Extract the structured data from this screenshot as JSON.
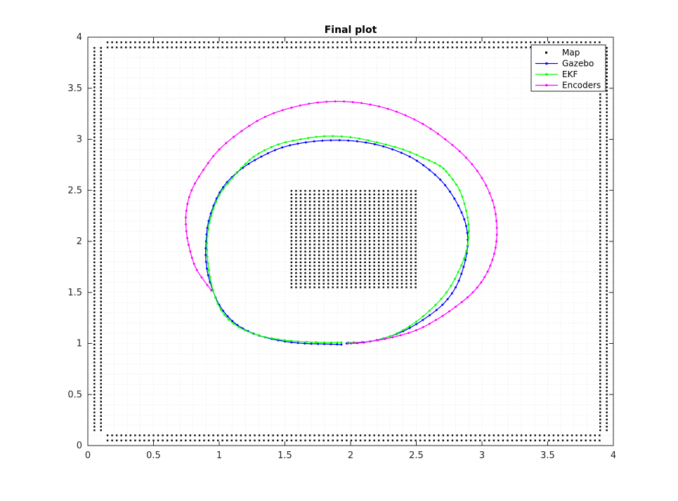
{
  "chart_data": {
    "type": "scatter",
    "title": "Final plot",
    "xlabel": "",
    "ylabel": "",
    "xlim": [
      0,
      4
    ],
    "ylim": [
      0,
      4
    ],
    "xticks": [
      "0",
      "0.5",
      "1",
      "1.5",
      "2",
      "2.5",
      "3",
      "3.5",
      "4"
    ],
    "yticks": [
      "0",
      "0.5",
      "1",
      "1.5",
      "2",
      "2.5",
      "3",
      "3.5",
      "4"
    ],
    "grid": "minor",
    "legend_position": "top-right",
    "series": [
      {
        "name": "Map",
        "kind": "points",
        "color": "#000000",
        "groups": [
          {
            "axis": "x",
            "from": 0.15,
            "to": 3.9,
            "step": 0.035,
            "fixed": [
              0.05,
              0.1
            ]
          },
          {
            "axis": "x",
            "from": 0.15,
            "to": 3.9,
            "step": 0.035,
            "fixed": [
              3.9,
              3.95
            ]
          },
          {
            "axis": "y",
            "from": 0.15,
            "to": 3.9,
            "step": 0.035,
            "fixed": [
              0.05,
              0.1
            ]
          },
          {
            "axis": "y",
            "from": 0.15,
            "to": 3.9,
            "step": 0.035,
            "fixed": [
              3.9,
              3.95
            ]
          },
          {
            "axis": "block",
            "x": [
              1.55,
              2.5
            ],
            "y": [
              1.55,
              2.5
            ],
            "step": 0.035
          }
        ]
      },
      {
        "name": "Gazebo",
        "kind": "line",
        "color": "#0000ff",
        "points": [
          [
            1.93,
            0.99
          ],
          [
            1.8,
            0.995
          ],
          [
            1.65,
            1.0
          ],
          [
            1.5,
            1.02
          ],
          [
            1.35,
            1.06
          ],
          [
            1.22,
            1.12
          ],
          [
            1.1,
            1.22
          ],
          [
            1.0,
            1.38
          ],
          [
            0.93,
            1.6
          ],
          [
            0.9,
            1.8
          ],
          [
            0.9,
            2.0
          ],
          [
            0.92,
            2.2
          ],
          [
            0.98,
            2.42
          ],
          [
            1.06,
            2.58
          ],
          [
            1.18,
            2.72
          ],
          [
            1.32,
            2.83
          ],
          [
            1.48,
            2.92
          ],
          [
            1.66,
            2.97
          ],
          [
            1.85,
            2.99
          ],
          [
            2.05,
            2.98
          ],
          [
            2.25,
            2.93
          ],
          [
            2.45,
            2.83
          ],
          [
            2.6,
            2.7
          ],
          [
            2.72,
            2.55
          ],
          [
            2.82,
            2.35
          ],
          [
            2.88,
            2.15
          ],
          [
            2.89,
            1.95
          ],
          [
            2.86,
            1.75
          ],
          [
            2.8,
            1.55
          ],
          [
            2.7,
            1.38
          ],
          [
            2.55,
            1.23
          ],
          [
            2.4,
            1.12
          ],
          [
            2.25,
            1.05
          ],
          [
            2.1,
            1.01
          ],
          [
            1.97,
            1.0
          ]
        ]
      },
      {
        "name": "EKF",
        "kind": "line",
        "color": "#00ff00",
        "points": [
          [
            1.93,
            1.01
          ],
          [
            1.8,
            1.01
          ],
          [
            1.6,
            1.02
          ],
          [
            1.45,
            1.04
          ],
          [
            1.3,
            1.08
          ],
          [
            1.15,
            1.16
          ],
          [
            1.04,
            1.28
          ],
          [
            0.97,
            1.45
          ],
          [
            0.93,
            1.65
          ],
          [
            0.91,
            1.85
          ],
          [
            0.91,
            2.05
          ],
          [
            0.94,
            2.25
          ],
          [
            1.0,
            2.45
          ],
          [
            1.1,
            2.62
          ],
          [
            1.2,
            2.76
          ],
          [
            1.3,
            2.86
          ],
          [
            1.45,
            2.95
          ],
          [
            1.62,
            3.0
          ],
          [
            1.8,
            3.03
          ],
          [
            2.0,
            3.02
          ],
          [
            2.2,
            2.97
          ],
          [
            2.4,
            2.9
          ],
          [
            2.55,
            2.82
          ],
          [
            2.68,
            2.74
          ],
          [
            2.75,
            2.65
          ],
          [
            2.83,
            2.5
          ],
          [
            2.88,
            2.3
          ],
          [
            2.9,
            2.1
          ],
          [
            2.88,
            1.9
          ],
          [
            2.82,
            1.7
          ],
          [
            2.73,
            1.5
          ],
          [
            2.6,
            1.32
          ],
          [
            2.45,
            1.17
          ],
          [
            2.3,
            1.07
          ],
          [
            2.15,
            1.02
          ],
          [
            1.98,
            1.01
          ]
        ]
      },
      {
        "name": "Encoders",
        "kind": "line",
        "color": "#ff00ff",
        "points": [
          [
            1.98,
            1.0
          ],
          [
            2.15,
            1.02
          ],
          [
            2.32,
            1.06
          ],
          [
            2.5,
            1.13
          ],
          [
            2.65,
            1.23
          ],
          [
            2.8,
            1.36
          ],
          [
            2.93,
            1.5
          ],
          [
            3.02,
            1.65
          ],
          [
            3.08,
            1.82
          ],
          [
            3.11,
            2.0
          ],
          [
            3.11,
            2.2
          ],
          [
            3.08,
            2.4
          ],
          [
            3.0,
            2.62
          ],
          [
            2.88,
            2.82
          ],
          [
            2.72,
            3.0
          ],
          [
            2.55,
            3.15
          ],
          [
            2.35,
            3.27
          ],
          [
            2.15,
            3.34
          ],
          [
            1.95,
            3.37
          ],
          [
            1.75,
            3.36
          ],
          [
            1.55,
            3.31
          ],
          [
            1.35,
            3.22
          ],
          [
            1.17,
            3.08
          ],
          [
            1.0,
            2.9
          ],
          [
            0.88,
            2.7
          ],
          [
            0.79,
            2.5
          ],
          [
            0.75,
            2.3
          ],
          [
            0.75,
            2.1
          ],
          [
            0.78,
            1.9
          ],
          [
            0.83,
            1.72
          ],
          [
            0.94,
            1.52
          ]
        ]
      }
    ]
  }
}
